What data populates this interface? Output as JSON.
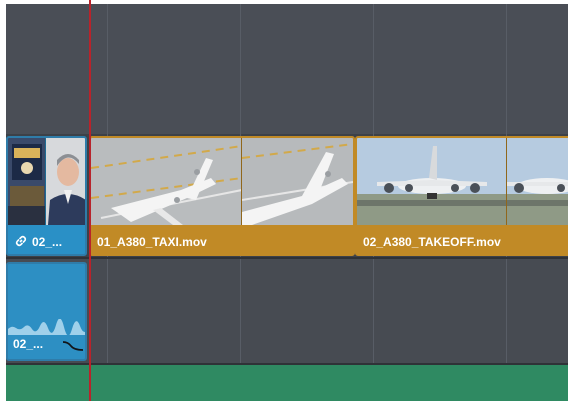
{
  "timeline": {
    "linked_clip": {
      "label": "02_..."
    },
    "video_clips": [
      {
        "label": "01_A380_TAXI.mov"
      },
      {
        "label": "02_A380_TAKEOFF.mov"
      }
    ],
    "audio_clip": {
      "label": "02_..."
    }
  },
  "icons": [
    "link-icon",
    "fade-curve-icon"
  ],
  "colors": {
    "selected_clip": "#c18a26",
    "linked_clip": "#2a90c6",
    "playhead": "#b8232b",
    "audio_track_green": "#2f8a62"
  }
}
